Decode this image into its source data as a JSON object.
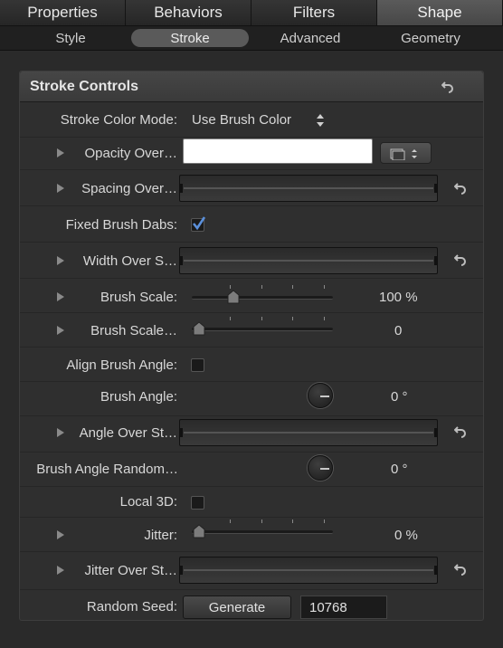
{
  "top_tabs": [
    "Properties",
    "Behaviors",
    "Filters",
    "Shape"
  ],
  "sub_tabs": [
    "Style",
    "Stroke",
    "Advanced",
    "Geometry"
  ],
  "panel": {
    "title": "Stroke Controls"
  },
  "rows": {
    "stroke_color_mode": {
      "label": "Stroke Color Mode:",
      "value": "Use Brush Color"
    },
    "opacity_over": {
      "label": "Opacity Over…"
    },
    "spacing_over": {
      "label": "Spacing Over…"
    },
    "fixed_brush_dabs": {
      "label": "Fixed Brush Dabs:",
      "checked": true
    },
    "width_over": {
      "label": "Width Over S…"
    },
    "brush_scale": {
      "label": "Brush Scale:",
      "value": "100 %",
      "fraction": 0.27
    },
    "brush_scale_2": {
      "label": "Brush Scale…",
      "value": "0",
      "fraction": 0.0
    },
    "align_brush_angle": {
      "label": "Align Brush Angle:",
      "checked": false
    },
    "brush_angle": {
      "label": "Brush Angle:",
      "value": "0 °"
    },
    "angle_over": {
      "label": "Angle Over St…"
    },
    "brush_angle_random": {
      "label": "Brush Angle Random…",
      "value": "0 °"
    },
    "local_3d": {
      "label": "Local 3D:",
      "checked": false
    },
    "jitter": {
      "label": "Jitter:",
      "value": "0 %",
      "fraction": 0.0
    },
    "jitter_over": {
      "label": "Jitter Over St…"
    },
    "random_seed": {
      "label": "Random Seed:",
      "button": "Generate",
      "value": "10768"
    }
  },
  "icons": {
    "reset": "reset-arrow-icon",
    "disclosure": "disclosure-triangle-icon",
    "popup": "up-down-arrows-icon",
    "checkmark": "checkmark-icon"
  },
  "colors": {
    "accent_check": "#5b8fd9",
    "active_tab": "#4f4f4f"
  }
}
